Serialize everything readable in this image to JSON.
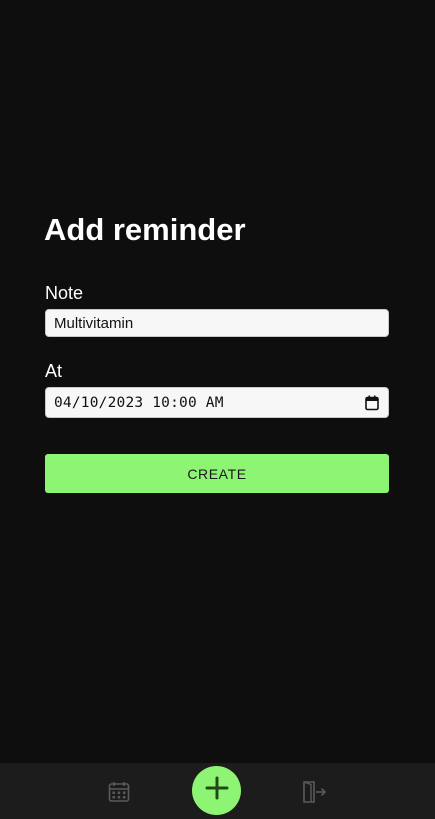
{
  "form": {
    "title": "Add reminder",
    "note_label": "Note",
    "note_value": "Multivitamin",
    "at_label": "At",
    "at_value": "04/10/2023 10:00 AM",
    "submit_label": "CREATE"
  },
  "bottom_nav": {
    "items": [
      {
        "icon": "calendar-icon"
      },
      {
        "icon": "plus-icon"
      },
      {
        "icon": "exit-icon"
      }
    ]
  },
  "colors": {
    "background": "#0e0e0e",
    "accent": "#8ef574",
    "nav_background": "#1c1c1c",
    "nav_icon": "#5a5a5a"
  }
}
